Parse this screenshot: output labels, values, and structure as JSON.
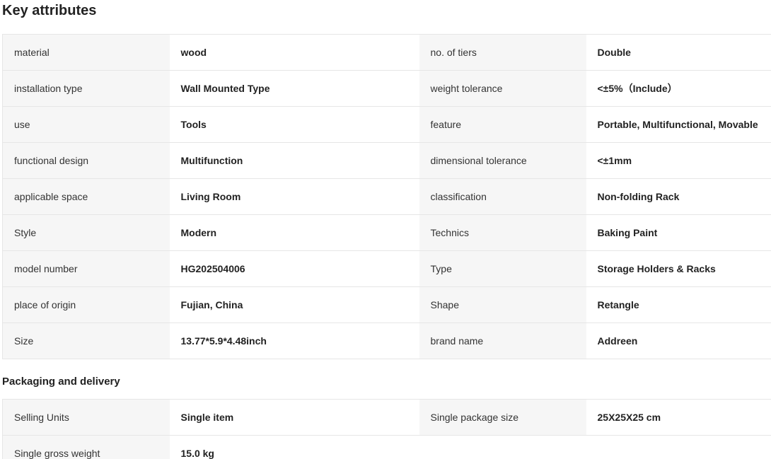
{
  "key_attributes": {
    "title": "Key attributes",
    "rows": [
      [
        {
          "k": "material",
          "v": "wood"
        },
        {
          "k": "no. of tiers",
          "v": "Double"
        }
      ],
      [
        {
          "k": "installation type",
          "v": "Wall Mounted Type"
        },
        {
          "k": "weight tolerance",
          "v": "<±5%（Include）"
        }
      ],
      [
        {
          "k": "use",
          "v": "Tools"
        },
        {
          "k": "feature",
          "v": "Portable, Multifunctional, Movable"
        }
      ],
      [
        {
          "k": "functional design",
          "v": "Multifunction"
        },
        {
          "k": "dimensional tolerance",
          "v": "<±1mm"
        }
      ],
      [
        {
          "k": "applicable space",
          "v": "Living Room"
        },
        {
          "k": "classification",
          "v": "Non-folding Rack"
        }
      ],
      [
        {
          "k": "Style",
          "v": "Modern"
        },
        {
          "k": "Technics",
          "v": "Baking Paint"
        }
      ],
      [
        {
          "k": "model number",
          "v": "HG202504006"
        },
        {
          "k": "Type",
          "v": "Storage Holders & Racks"
        }
      ],
      [
        {
          "k": "place of origin",
          "v": "Fujian, China"
        },
        {
          "k": "Shape",
          "v": "Retangle"
        }
      ],
      [
        {
          "k": "Size",
          "v": "13.77*5.9*4.48inch"
        },
        {
          "k": "brand name",
          "v": "Addreen"
        }
      ]
    ]
  },
  "packaging": {
    "title": "Packaging and delivery",
    "rows": [
      [
        {
          "k": "Selling Units",
          "v": "Single item"
        },
        {
          "k": "Single package size",
          "v": "25X25X25 cm"
        }
      ],
      [
        {
          "k": "Single gross weight",
          "v": "15.0 kg"
        },
        {
          "k": "",
          "v": ""
        }
      ]
    ]
  }
}
